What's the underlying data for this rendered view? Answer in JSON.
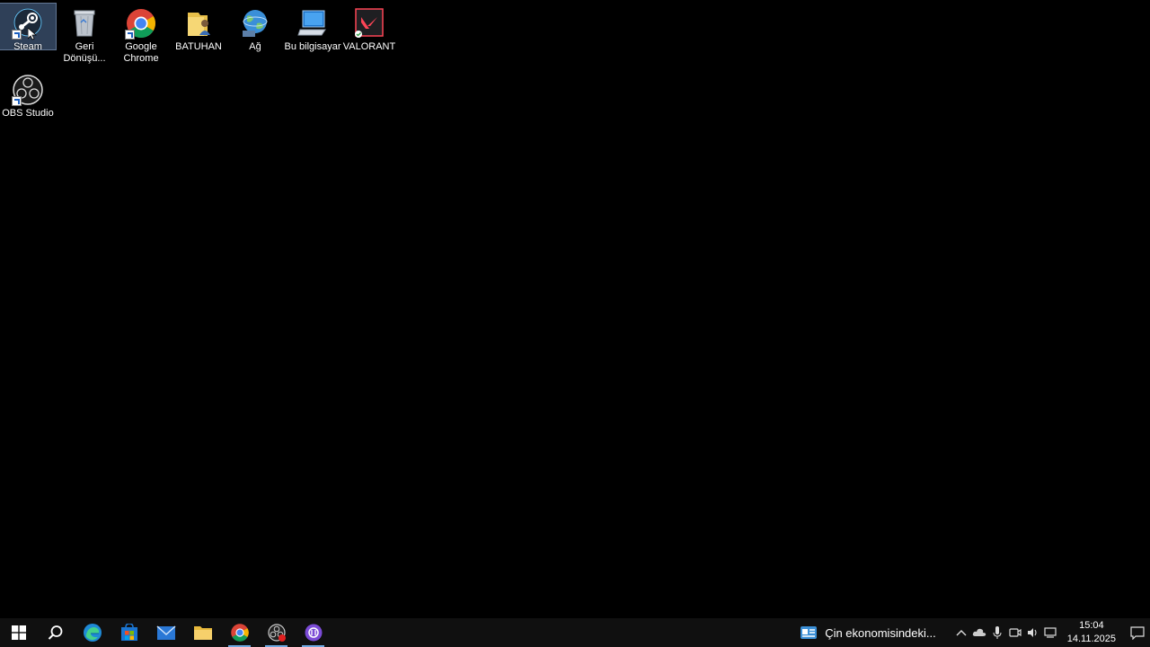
{
  "desktop": {
    "icons": [
      {
        "label": "Steam",
        "icon": "steam-icon"
      },
      {
        "label": "Geri\nDönüşü...",
        "icon": "recycle-bin-icon"
      },
      {
        "label": "Google\nChrome",
        "icon": "chrome-icon"
      },
      {
        "label": "BATUHAN",
        "icon": "user-folder-icon"
      },
      {
        "label": "Ağ",
        "icon": "network-icon"
      },
      {
        "label": "Bu bilgisayar",
        "icon": "this-pc-icon"
      },
      {
        "label": "VALORANT",
        "icon": "valorant-icon"
      },
      {
        "label": "OBS Studio",
        "icon": "obs-icon"
      }
    ]
  },
  "taskbar": {
    "apps": [
      "start",
      "search",
      "edge",
      "store",
      "mail",
      "file-explorer",
      "chrome",
      "obs",
      "app"
    ],
    "news": "Çin ekonomisindeki...",
    "clock": {
      "time": "15:04",
      "date": "14.11.2025"
    }
  },
  "colors": {
    "accent": "#6fa8e0",
    "taskbar_bg": "#101010",
    "desktop_bg": "#000000",
    "selection": "#5674a0"
  }
}
